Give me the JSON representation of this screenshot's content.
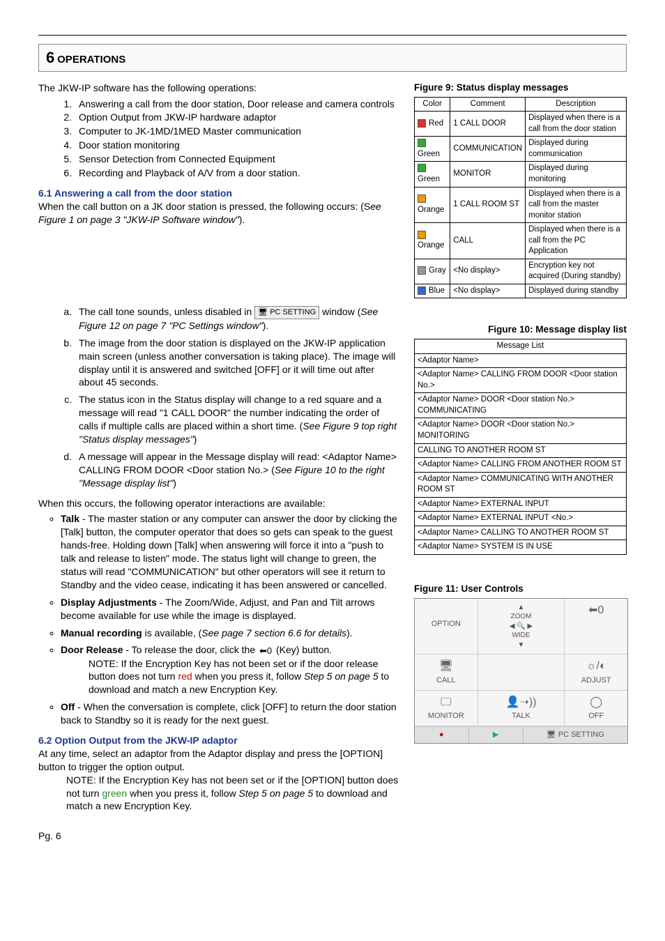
{
  "section": {
    "num": "6",
    "title": "OPERATIONS"
  },
  "intro": "The JKW-IP software has the following operations:",
  "ops": [
    "Answering a call from the door station, Door release and camera controls",
    "Option Output from JKW-IP hardware adaptor",
    "Computer to JK-1MD/1MED Master communication",
    "Door station monitoring",
    "Sensor Detection from Connected Equipment",
    "Recording and Playback of A/V from a door station."
  ],
  "sub61": {
    "heading": "6.1      Answering a call from the door station",
    "intro_a": "When the call button on a JK door station is pressed, the following occurs: (S",
    "intro_ref": "ee Figure 1 on page 3 \"JKW-IP Software window\"",
    "intro_c": ")."
  },
  "steps": {
    "a_pre": "The call tone sounds, unless disabled in ",
    "a_btn": "PC SETTING",
    "a_post": " window (",
    "a_ref": "See Figure 12 on page 7 \"PC Settings window\"",
    "a_end": ").",
    "b": "The image from the door station is displayed on the JKW-IP application main screen (unless another conversation is taking place).  The image will display until it is answered and switched [OFF] or it will time out after about 45 seconds.",
    "c_pre": "The status icon in the Status display will change to a red square and a message will read \"1 CALL DOOR\" the number indicating the order of calls if multiple calls are placed within a short time. (",
    "c_ref": "See Figure 9 top right \"Status display messages\"",
    "c_end": ")",
    "d_pre": "A message will appear in the Message display will read: <Adaptor Name> CALLING FROM DOOR <Door station No.> (",
    "d_ref": "See Figure 10 to the right \"Message display list\"",
    "d_end": ")"
  },
  "interact_intro": "When this occurs, the following operator interactions are available:",
  "bullets": {
    "talk_label": "Talk",
    "talk_text": " - The master station or any computer can answer the door by clicking the [Talk] button, the computer operator that does so gets can speak to the guest hands-free.  Holding down [Talk] when answering will force it into a \"push to talk and release to listen\" mode. The status light will change to green, the status will read \"COMMUNICATION\" but other operators will see it return to Standby and the video cease, indicating it has been answered or cancelled.",
    "disp_label": "Display Adjustments",
    "disp_text": " - The Zoom/Wide, Adjust, and Pan and Tilt arrows become available for use while the image is displayed.",
    "man_label": "Manual recording",
    "man_text_a": " is available, (",
    "man_ref": "See page 7 section 6.6 for details",
    "man_text_b": ").",
    "door_label": "Door Release",
    "door_text_a": " - To release the door, click the  ",
    "door_text_b": "  (Key) button.",
    "door_note_a": "NOTE: If the Encryption Key has not been set or if the door release button does not turn ",
    "door_note_red": "red",
    "door_note_b": " when you press it, follow ",
    "door_note_ref": "Step 5 on page 5",
    "door_note_c": " to download and match a new Encryption Key.",
    "off_label": "Off",
    "off_text": " - When the conversation is complete, click [OFF] to return the door station back to Standby so it is ready for the next guest."
  },
  "sub62": {
    "heading": "6.2 Option Output from the JKW-IP adaptor",
    "p1": "At any time, select an adaptor from the Adaptor display and press the [OPTION] button to trigger the option output.",
    "note_a": "NOTE: If the Encryption Key has not been set or if the [OPTION] button does not turn ",
    "note_green": "green",
    "note_b": " when you press it, follow ",
    "note_ref": "Step 5 on page 5",
    "note_c": " to download and match a new Encryption Key."
  },
  "fig9": {
    "caption": "Figure 9: Status display messages",
    "headers": [
      "Color",
      "Comment",
      "Description"
    ],
    "rows": [
      {
        "c": "Red",
        "sw": "#d33",
        "cm": "1 CALL DOOR",
        "d": "Displayed when there is a call from the door station"
      },
      {
        "c": "Green",
        "sw": "#3a3",
        "cm": "COMMUNICATION",
        "d": "Displayed during communication"
      },
      {
        "c": "Green",
        "sw": "#3a3",
        "cm": "MONITOR",
        "d": "Displayed during monitoring"
      },
      {
        "c": "Orange",
        "sw": "#e90",
        "cm": "1 CALL ROOM ST",
        "d": "Displayed when there is a call from the master monitor station"
      },
      {
        "c": "Orange",
        "sw": "#e90",
        "cm": "CALL",
        "d": "Displayed when there is a call from the PC Application"
      },
      {
        "c": "Gray",
        "sw": "#999",
        "cm": "<No display>",
        "d": "Encryption key not acquired (During standby)"
      },
      {
        "c": "Blue",
        "sw": "#36c",
        "cm": "<No display>",
        "d": "Displayed during standby"
      }
    ]
  },
  "fig10": {
    "caption": "Figure 10: Message display list",
    "header": "Message List",
    "rows": [
      "<Adaptor Name>",
      "<Adaptor Name> CALLING FROM DOOR <Door station No.>",
      "<Adaptor Name> DOOR <Door station No.> COMMUNICATING",
      "<Adaptor Name> DOOR <Door station No.> MONITORING",
      "CALLING TO ANOTHER ROOM ST",
      "<Adaptor Name> CALLING FROM ANOTHER ROOM ST",
      "<Adaptor Name> COMMUNICATING WITH ANOTHER ROOM ST",
      "<Adaptor Name> EXTERNAL INPUT",
      "<Adaptor Name> EXTERNAL INPUT <No.>",
      "<Adaptor Name> CALLING TO ANOTHER ROOM ST",
      "<Adaptor Name> SYSTEM IS IN USE"
    ]
  },
  "fig11": {
    "caption": "Figure 11: User Controls",
    "labels": {
      "option": "OPTION",
      "key": "⬅0",
      "call": "CALL",
      "adjust": "ADJUST",
      "monitor": "MONITOR",
      "talk": "TALK",
      "off": "OFF",
      "zoom": "ZOOM",
      "wide": "WIDE",
      "pcsetting": "PC SETTING",
      "adjust_icon": "☼/◐",
      "talk_icon": "👤➝))",
      "off_icon": "◯",
      "call_icon": "🖥",
      "monitor_icon": "🖵",
      "rec": "●",
      "play": "▶"
    }
  },
  "page": "Pg. 6"
}
